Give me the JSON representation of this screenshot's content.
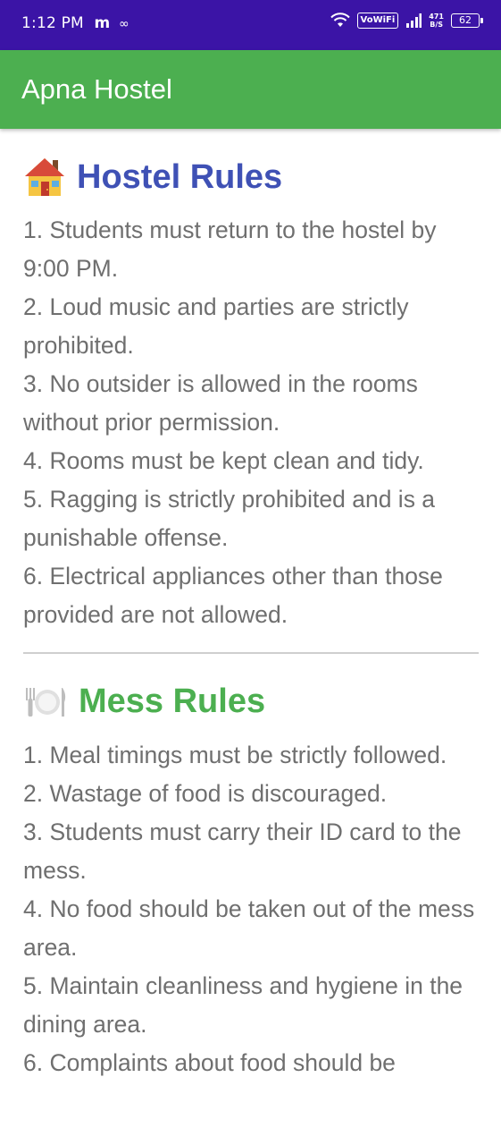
{
  "status_bar": {
    "time": "1:12 PM",
    "app_indicator": "m",
    "infinity": "∞",
    "vowifi": "VoWiFi",
    "speed_value": "471",
    "speed_unit": "B/S",
    "battery": "62"
  },
  "app_bar": {
    "title": "Apna Hostel"
  },
  "sections": {
    "hostel": {
      "heading": "Hostel Rules",
      "icon": "house-icon",
      "rules": [
        "1. Students must return to the hostel by 9:00 PM.",
        "2. Loud music and parties are strictly prohibited.",
        "3. No outsider is allowed in the rooms without prior permission.",
        "4. Rooms must be kept clean and tidy.",
        "5. Ragging is strictly prohibited and is a punishable offense.",
        "6. Electrical appliances other than those provided are not allowed."
      ]
    },
    "mess": {
      "heading": "Mess Rules",
      "icon": "plate-cutlery-icon",
      "rules": [
        "1. Meal timings must be strictly followed.",
        "2. Wastage of food is discouraged.",
        "3. Students must carry their ID card to the mess.",
        "4. No food should be taken out of the mess area.",
        "5. Maintain cleanliness and hygiene in the dining area.",
        "6. Complaints about food should be"
      ]
    }
  },
  "colors": {
    "status_bar": "#3b14a6",
    "app_bar": "#4caf50",
    "hostel_heading": "#3f51b5",
    "mess_heading": "#4caf50",
    "body_text": "#6f6f6f"
  }
}
